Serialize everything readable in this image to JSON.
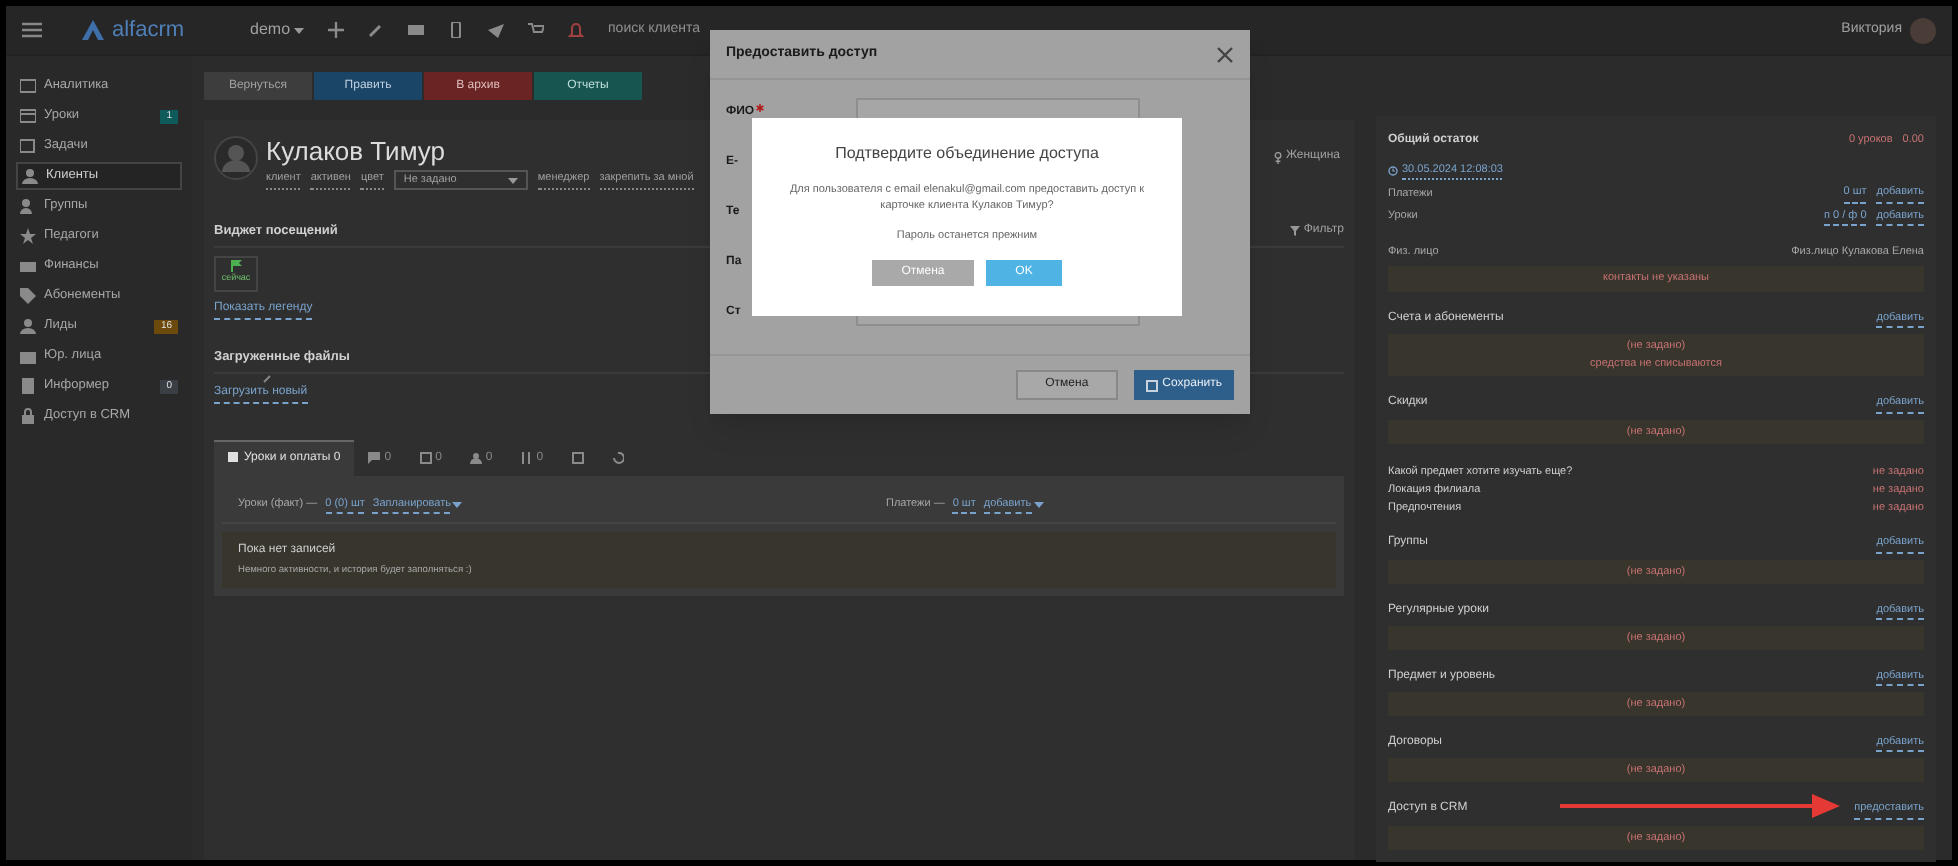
{
  "navbar": {
    "logo": "alfacrm",
    "branch": "demo",
    "search_placeholder": "поиск клиента",
    "user": "Виктория"
  },
  "sidebar": {
    "items": [
      {
        "label": "Аналитика",
        "selected": false
      },
      {
        "label": "Уроки",
        "selected": false,
        "badge": "1",
        "color": "#0f5b5b"
      },
      {
        "label": "Задачи",
        "selected": false
      },
      {
        "label": "Клиенты",
        "selected": true
      },
      {
        "label": "Группы",
        "selected": false
      },
      {
        "label": "Педагоги",
        "selected": false
      },
      {
        "label": "Финансы",
        "selected": false
      },
      {
        "label": "Абонементы",
        "selected": false
      },
      {
        "label": "Лиды",
        "selected": false,
        "badge": "16",
        "color": "#6b4a0c"
      },
      {
        "label": "Юр. лица",
        "selected": false
      },
      {
        "label": "Информер",
        "selected": false,
        "badge": "0",
        "color": "#3a3f45"
      },
      {
        "label": "Доступ в CRM",
        "selected": false
      }
    ]
  },
  "toolbar": [
    {
      "label": "Вернуться",
      "kind": "back"
    },
    {
      "label": "Править",
      "kind": "edit"
    },
    {
      "label": "В архив",
      "kind": "archive"
    },
    {
      "label": "Отчеты",
      "kind": "reports"
    }
  ],
  "client": {
    "name": "Кулаков Тимур",
    "meta": [
      "клиент",
      "активен",
      "цвет"
    ],
    "color_select": "Не задано",
    "manager_label": "менеджер",
    "assign_link": "закрепить за мной",
    "gender": "Женщина"
  },
  "attendance_widget": {
    "title": "Виджет посещений",
    "now_label": "сейчас",
    "legend_link": "Показать легенду",
    "filter": "Фильтр"
  },
  "files": {
    "title": "Загруженные файлы",
    "upload_link": "Загрузить новый"
  },
  "tabs": [
    {
      "label": "Уроки и оплаты 0",
      "selected": true
    },
    {
      "label": "0",
      "selected": false
    },
    {
      "label": "0",
      "selected": false
    },
    {
      "label": "0",
      "selected": false
    },
    {
      "label": "0",
      "selected": false
    },
    {
      "selected": false
    },
    {
      "selected": false
    }
  ],
  "lessons": {
    "fact_label": "Уроки (факт) —",
    "fact_count": "0 (0) шт",
    "plan_link": "Запланировать",
    "payments_label": "Платежи —",
    "payments_count": "0 шт",
    "add_link": "добавить",
    "empty_title": "Пока нет записей",
    "empty_text": "Немного активности, и история будет заполняться :)"
  },
  "summary": {
    "title": "Общий остаток",
    "lessons_left": "0 уроков",
    "balance": "0.00",
    "date": "30.05.2024 12:08:03",
    "rows": [
      {
        "label": "Платежи",
        "value": "0 шт",
        "action": "добавить"
      },
      {
        "label": "Уроки",
        "value": "п 0 / ф 0",
        "action": "добавить"
      }
    ],
    "person_label": "Физ. лицо",
    "person_value": "Физ.лицо Кулакова Елена",
    "contacts_note": "контакты не указаны"
  },
  "sections_top": [
    {
      "title": "Счета и абонементы",
      "action": "добавить",
      "lines": [
        "(не задано)",
        "средства не списываются"
      ]
    },
    {
      "title": "Скидки",
      "action": "добавить",
      "lines": [
        "(не задано)"
      ]
    }
  ],
  "custom_fields": [
    {
      "label": "Какой предмет хотите изучать еще?",
      "value": "не задано"
    },
    {
      "label": "Локация филиала",
      "value": "не задано"
    },
    {
      "label": "Предпочтения",
      "value": "не задано"
    }
  ],
  "sections_bottom": [
    {
      "title": "Группы",
      "action": "добавить",
      "lines": [
        "(не задано)"
      ]
    },
    {
      "title": "Регулярные уроки",
      "action": "добавить",
      "lines": [
        "(не задано)"
      ]
    },
    {
      "title": "Предмет и уровень",
      "action": "добавить",
      "lines": [
        "(не задано)"
      ]
    },
    {
      "title": "Договоры",
      "action": "добавить",
      "lines": [
        "(не задано)"
      ]
    },
    {
      "title": "Доступ в CRM",
      "action": "предоставить",
      "lines": [
        "(не задано)"
      ]
    }
  ],
  "access_dialog": {
    "title": "Предоставить доступ",
    "fields": [
      {
        "label": "ФИО",
        "required": true
      },
      {
        "label": "E-"
      },
      {
        "label": "Те"
      },
      {
        "label": "Па"
      },
      {
        "label": "Ст"
      }
    ],
    "cancel": "Отмена",
    "save": "Сохранить"
  },
  "confirm_dialog": {
    "title": "Подтвердите объединение доступа",
    "message": "Для пользователя с email elenakul@gmail.com предоставить доступ к карточке клиента Кулаков Тимур?",
    "note": "Пароль останется прежним",
    "cancel": "Отмена",
    "ok": "OK"
  }
}
